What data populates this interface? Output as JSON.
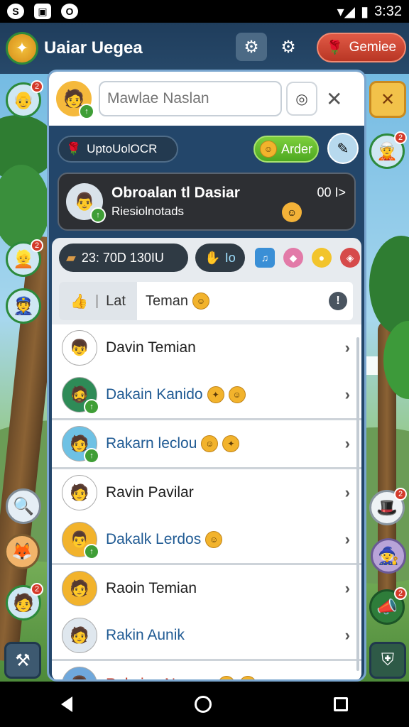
{
  "status_bar": {
    "icons_left": [
      "S",
      "▣",
      "O"
    ],
    "time": "3:32",
    "signal": "▾◢",
    "battery": "▮"
  },
  "app": {
    "title": "Uaiar Uegea",
    "games_button": "Gemiee"
  },
  "search": {
    "placeholder": "Mawlae Naslan",
    "value": ""
  },
  "chips": {
    "filter_label": "UptoUolOCR",
    "order_button": "Arder"
  },
  "featured": {
    "title": "Obroalan tl Dasiar",
    "subtitle": "Riesiolnotads",
    "count": "00 I>"
  },
  "inventory": {
    "currency_label": "23: 70D  130IU",
    "item_label": "Io"
  },
  "tabs": {
    "like": "Lat",
    "team": "Teman"
  },
  "friends": [
    {
      "name": "Davin Temian",
      "style": "normal",
      "avatar": "👦",
      "bg": "#ffffff",
      "online": false,
      "emojis": []
    },
    {
      "name": "Dakain Kanido",
      "style": "blue",
      "avatar": "🧔",
      "bg": "#2e8b57",
      "online": true,
      "emojis": [
        "✦",
        "☺"
      ]
    },
    {
      "name": "Rakarn leclou",
      "style": "blue",
      "avatar": "🧑",
      "bg": "#6ec1e4",
      "online": true,
      "emojis": [
        "☺",
        "✦"
      ]
    },
    {
      "name": "Ravin Pavilar",
      "style": "normal",
      "avatar": "🧑",
      "bg": "#ffffff",
      "online": false,
      "emojis": []
    },
    {
      "name": "Dakalk Lerdos",
      "style": "blue",
      "avatar": "👨",
      "bg": "#f2b32c",
      "online": true,
      "emojis": [
        "☺"
      ]
    },
    {
      "name": "Raoin Temian",
      "style": "normal",
      "avatar": "🧑",
      "bg": "#f2b32c",
      "online": false,
      "emojis": []
    },
    {
      "name": "Rakin Aunik",
      "style": "blue",
      "avatar": "🧑",
      "bg": "#dfe7ee",
      "online": false,
      "emojis": []
    },
    {
      "name": "Rakain aNerunu",
      "style": "red",
      "avatar": "👩",
      "bg": "#6fa8dc",
      "online": true,
      "emojis": [
        "✦",
        "☺"
      ]
    }
  ],
  "nav": {
    "back": "back-icon",
    "home": "home-icon",
    "recent": "recent-apps-icon"
  }
}
